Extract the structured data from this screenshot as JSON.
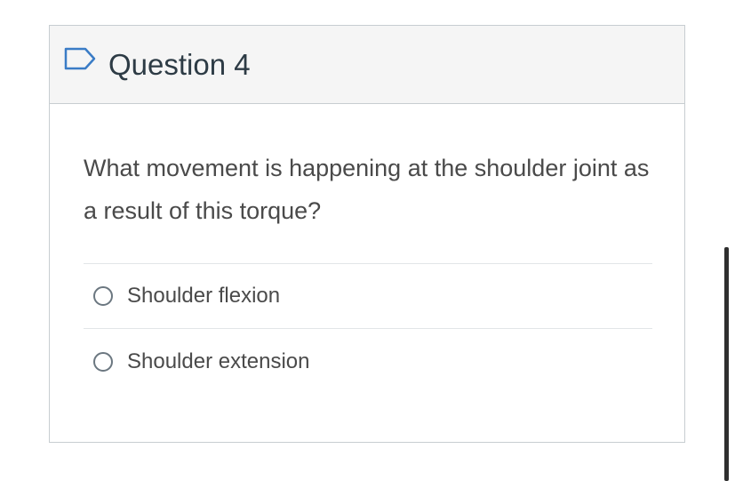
{
  "question": {
    "title": "Question 4",
    "flag_icon": "flag-outline-icon",
    "text": "What movement is happening at the shoulder joint as a result of this torque?",
    "answers": [
      {
        "label": "Shoulder flexion",
        "selected": false
      },
      {
        "label": "Shoulder extension",
        "selected": false
      }
    ]
  },
  "colors": {
    "header_background": "#f5f5f5",
    "border": "#c7cdd1",
    "text": "#4a4a4a",
    "title": "#2d3b45"
  }
}
